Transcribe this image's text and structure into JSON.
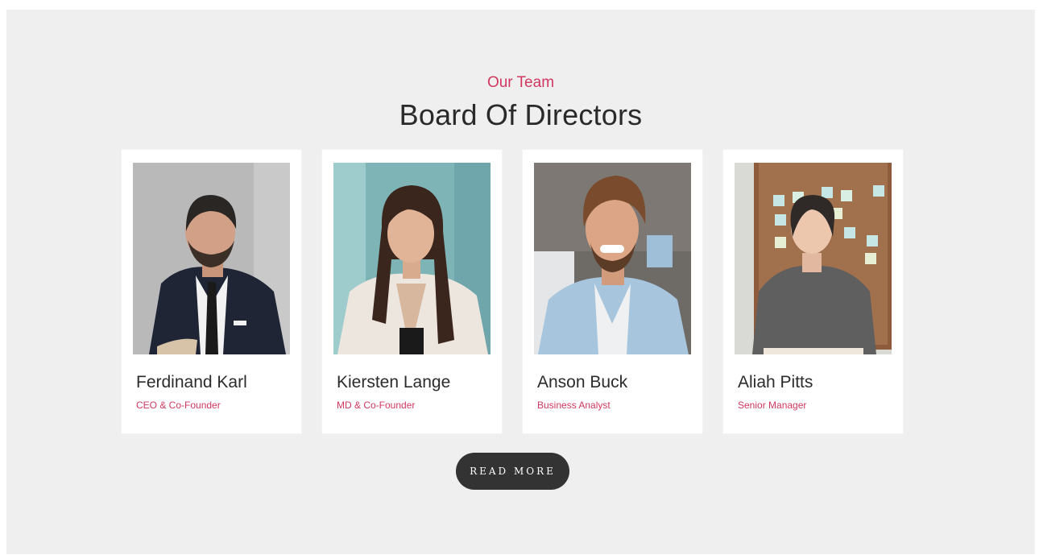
{
  "header": {
    "eyebrow": "Our Team",
    "title": "Board Of Directors"
  },
  "team": [
    {
      "name": "Ferdinand Karl",
      "role": "CEO & Co-Founder",
      "photo": "man-in-suit-photo"
    },
    {
      "name": "Kiersten Lange",
      "role": "MD & Co-Founder",
      "photo": "woman-long-hair-photo"
    },
    {
      "name": "Anson Buck",
      "role": "Business Analyst",
      "photo": "smiling-man-denim-shirt-photo"
    },
    {
      "name": "Aliah Pitts",
      "role": "Senior Manager",
      "photo": "woman-corkboard-photo"
    }
  ],
  "cta": {
    "label": "READ MORE"
  },
  "colors": {
    "accent": "#d0385f",
    "background": "#efefef",
    "button": "#333333"
  }
}
